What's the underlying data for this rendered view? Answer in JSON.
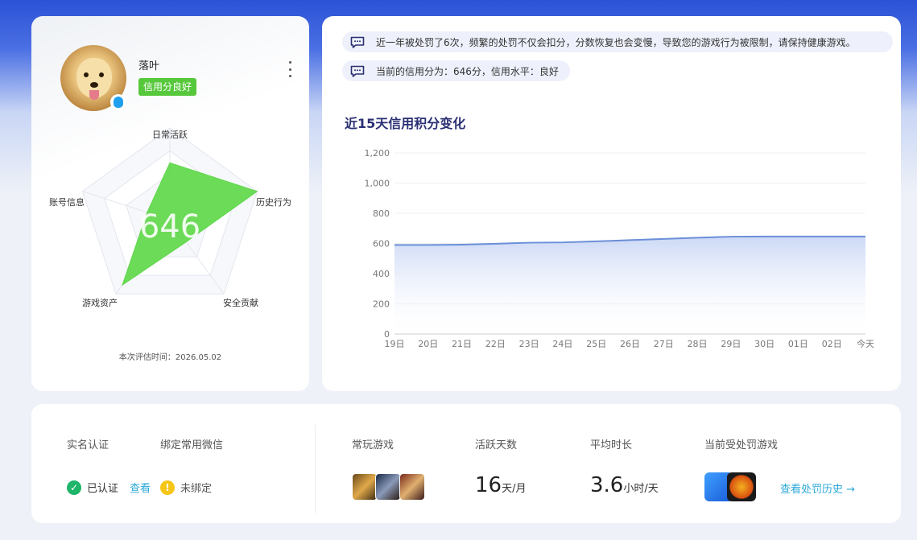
{
  "profile": {
    "username": "落叶",
    "credit_tag": "信用分良好",
    "score": "646",
    "radar_labels": [
      "日常活跃",
      "历史行为",
      "安全贡献",
      "游戏资产",
      "账号信息"
    ],
    "radar_levels": [
      0.62,
      1.0,
      0.3,
      0.88,
      0.26
    ],
    "eval_prefix": "本次评估时间：",
    "eval_date": "2026.05.02"
  },
  "notices": {
    "penalty": "近一年被处罚了6次，频繁的处罚不仅会扣分，分数恢复也会变慢，导致您的游戏行为被限制，请保持健康游戏。",
    "current": "当前的信用分为：646分，信用水平：良好"
  },
  "chart_data": {
    "type": "area",
    "title": "近15天信用积分变化",
    "categories": [
      "19日",
      "20日",
      "21日",
      "22日",
      "23日",
      "24日",
      "25日",
      "26日",
      "27日",
      "28日",
      "29日",
      "30日",
      "01日",
      "02日",
      "今天"
    ],
    "values": [
      590,
      590,
      592,
      598,
      605,
      607,
      614,
      622,
      630,
      638,
      645,
      646,
      646,
      646,
      646
    ],
    "y_ticks": [
      "0",
      "200",
      "400",
      "600",
      "800",
      "1,000",
      "1,200"
    ],
    "ylim": [
      0,
      1200
    ],
    "line_color": "#6b8fd8",
    "fill_color": "#c9d6f5"
  },
  "bottom": {
    "realname_label": "实名认证",
    "realname_status": "已认证",
    "realname_link": "查看",
    "wechat_label": "绑定常用微信",
    "wechat_status": "未绑定",
    "games_label": "常玩游戏",
    "active_days_label": "活跃天数",
    "active_days_value": "16",
    "active_days_unit": "天/月",
    "avg_time_label": "平均时长",
    "avg_time_value": "3.6",
    "avg_time_unit": "小时/天",
    "penalized_label": "当前受处罚游戏",
    "history_link": "查看处罚历史 →",
    "colors": {
      "verified": "#1fb56a",
      "warning": "#f5c518",
      "link": "#2aa8d8"
    }
  }
}
